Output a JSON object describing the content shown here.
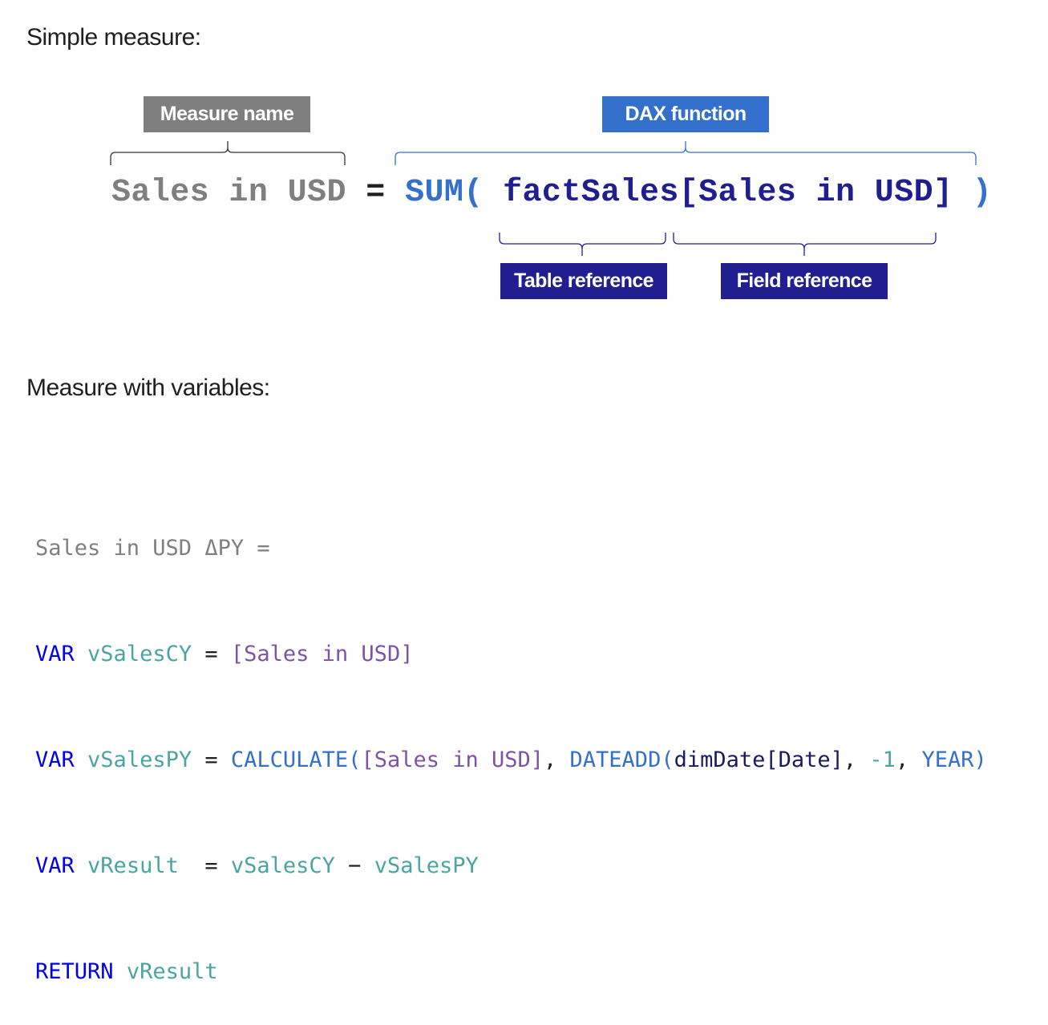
{
  "simple": {
    "heading": "Simple measure:",
    "tags": {
      "measure_name": "Measure name",
      "dax_function": "DAX function",
      "table_reference": "Table reference",
      "field_reference": "Field reference"
    },
    "formula": {
      "name": "Sales in USD",
      "equals": " = ",
      "func": "SUM(",
      "space": " ",
      "table": "factSales",
      "field": "[Sales in USD]",
      "close": " )"
    }
  },
  "variables": {
    "heading": "Measure with variables:",
    "lines": [
      {
        "header": "Sales in USD ΔPY ="
      },
      {
        "kw": "VAR",
        "var": "vSalesCY",
        "eq": " = ",
        "measure": "[Sales in USD]"
      },
      {
        "kw": "VAR",
        "var": "vSalesPY",
        "eq": " = ",
        "fn1": "CALCULATE(",
        "measure": "[Sales in USD]",
        "comma1": ", ",
        "fn2": "DATEADD(",
        "table": "dimDate[Date]",
        "comma2": ", ",
        "num": "-1",
        "comma3": ", ",
        "year": "YEAR)"
      },
      {
        "kw": "VAR",
        "var": "vResult",
        "eq": "  = ",
        "a": "vSalesCY",
        "minus": " − ",
        "b": "vSalesPY"
      },
      {
        "kw": "RETURN",
        "var": "vResult"
      }
    ]
  },
  "colors": {
    "grey": "#7f7f7f",
    "blue": "#3370cc",
    "navy": "#211f8f",
    "keyword": "#0000ee",
    "variable": "#4aa5a0",
    "measure": "#7f52a6"
  }
}
